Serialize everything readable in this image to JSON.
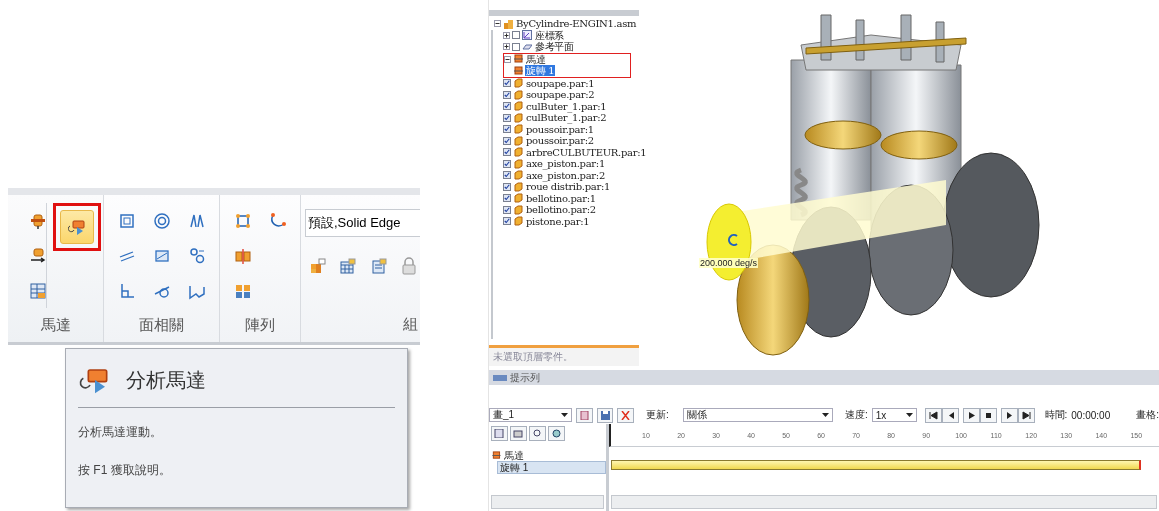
{
  "ribbon": {
    "groups": [
      {
        "label": "馬達",
        "buttons": [
          {
            "kind": "motor",
            "highlighted": false,
            "annotated": false
          },
          {
            "kind": "motor-arrow",
            "highlighted": false,
            "annotated": false
          },
          {
            "kind": "table",
            "highlighted": false,
            "annotated": false
          },
          {
            "kind": "motor-play",
            "highlighted": true,
            "annotated": true
          }
        ]
      },
      {
        "label": "面相關",
        "buttons": [
          {
            "kind": "square",
            "highlighted": false,
            "annotated": false
          },
          {
            "kind": "parallel",
            "highlighted": false,
            "annotated": false
          },
          {
            "kind": "angle",
            "highlighted": false,
            "annotated": false
          },
          {
            "kind": "concentric",
            "highlighted": false,
            "annotated": false
          },
          {
            "kind": "plane",
            "highlighted": false,
            "annotated": false
          },
          {
            "kind": "tangent",
            "highlighted": false,
            "annotated": false
          },
          {
            "kind": "mirror",
            "highlighted": false,
            "annotated": false
          },
          {
            "kind": "circles",
            "highlighted": false,
            "annotated": false
          },
          {
            "kind": "connect",
            "highlighted": false,
            "annotated": false
          }
        ]
      },
      {
        "label": "陣列",
        "buttons": [
          {
            "kind": "pattern",
            "highlighted": false,
            "annotated": false
          },
          {
            "kind": "mirror-parts",
            "highlighted": false,
            "annotated": false
          },
          {
            "kind": "grid",
            "highlighted": false,
            "annotated": false
          },
          {
            "kind": "curve",
            "highlighted": false,
            "annotated": false
          }
        ]
      },
      {
        "label": "組",
        "field": {
          "value": "預設,Solid Edge"
        },
        "buttons": [
          {
            "kind": "assembly",
            "highlighted": false,
            "annotated": false
          },
          {
            "kind": "table-window",
            "highlighted": false,
            "annotated": false
          },
          {
            "kind": "note",
            "highlighted": false,
            "annotated": false
          },
          {
            "kind": "lock",
            "highlighted": false,
            "annotated": false
          }
        ]
      }
    ]
  },
  "tooltip": {
    "title": "分析馬達",
    "description": "分析馬達運動。",
    "help": "按 F1 獲取說明。"
  },
  "assembly_tree": {
    "root": {
      "label": "ByCylindre-ENGIN1.asm",
      "kind": "assembly",
      "expanded": true,
      "selected": false,
      "annotated": false,
      "children": [
        {
          "label": "座標系",
          "kind": "coordinate-system",
          "expanded": false,
          "checked": false,
          "selected": false,
          "annotated": false
        },
        {
          "label": "參考平面",
          "kind": "reference-plane",
          "expanded": false,
          "checked": false,
          "selected": false,
          "annotated": false
        },
        {
          "label": "馬達",
          "kind": "motor",
          "expanded": true,
          "selected": false,
          "annotated": true,
          "children": [
            {
              "label": "旋轉 1",
              "kind": "motor",
              "selected": true,
              "annotated": false
            }
          ]
        },
        {
          "label": "soupape.par:1",
          "kind": "part",
          "checked": true,
          "selected": false,
          "annotated": false
        },
        {
          "label": "soupape.par:2",
          "kind": "part",
          "checked": true,
          "selected": false,
          "annotated": false
        },
        {
          "label": "culButer_1.par:1",
          "kind": "part",
          "checked": true,
          "selected": false,
          "annotated": false
        },
        {
          "label": "culButer_1.par:2",
          "kind": "part",
          "checked": true,
          "selected": false,
          "annotated": false
        },
        {
          "label": "poussoir.par:1",
          "kind": "part",
          "checked": true,
          "selected": false,
          "annotated": false
        },
        {
          "label": "poussoir.par:2",
          "kind": "part",
          "checked": true,
          "selected": false,
          "annotated": false
        },
        {
          "label": "arbreCULBUTEUR.par:1",
          "kind": "part",
          "checked": true,
          "selected": false,
          "annotated": false
        },
        {
          "label": "axe_piston.par:1",
          "kind": "part",
          "checked": true,
          "selected": false,
          "annotated": false
        },
        {
          "label": "axe_piston.par:2",
          "kind": "part",
          "checked": true,
          "selected": false,
          "annotated": false
        },
        {
          "label": "roue distrib.par:1",
          "kind": "part",
          "checked": true,
          "selected": false,
          "annotated": false
        },
        {
          "label": "bellotino.par:1",
          "kind": "part",
          "checked": true,
          "selected": false,
          "annotated": false
        },
        {
          "label": "bellotino.par:2",
          "kind": "part",
          "checked": true,
          "selected": false,
          "annotated": false
        },
        {
          "label": "pistone.par:1",
          "kind": "part",
          "checked": true,
          "selected": false,
          "annotated": false
        }
      ]
    },
    "status": "未選取頂層零件。"
  },
  "viewport": {
    "motor_label": "200.000 deg/s"
  },
  "hint_bar": {
    "title": "提示列"
  },
  "animation_toolbar": {
    "animation": "畫_1",
    "update_label": "更新:",
    "update_value": "關係",
    "speed_label": "速度:",
    "speed_value": "1x",
    "time_label": "時間:",
    "time_value": "00:00:00",
    "frame_label": "畫格:"
  },
  "timeline": {
    "ticks": [
      "10",
      "20",
      "30",
      "40",
      "50",
      "60",
      "70",
      "80",
      "90",
      "100",
      "110",
      "120",
      "130",
      "140",
      "150"
    ],
    "tracks": [
      {
        "label": "馬達",
        "selected": false,
        "children": [
          {
            "label": "旋轉 1",
            "selected": true
          }
        ]
      }
    ]
  }
}
